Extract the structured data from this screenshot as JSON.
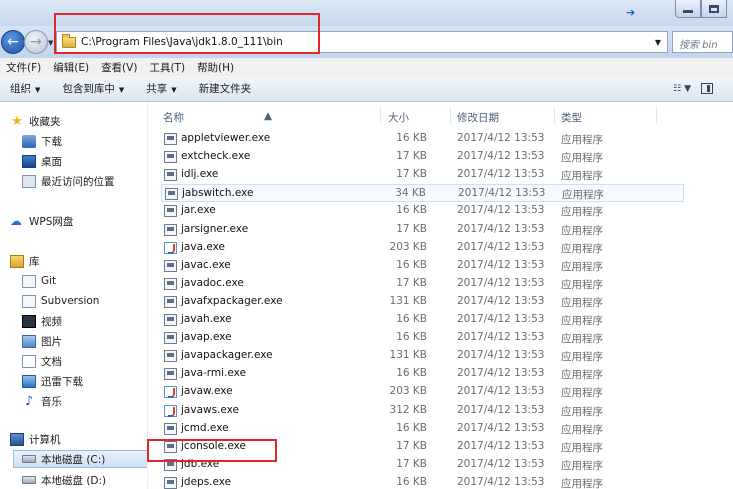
{
  "window": {
    "nav_arrow": "➔",
    "minimize": "minimize",
    "maximize": "maximize"
  },
  "address": {
    "path": "C:\\Program Files\\Java\\jdk1.8.0_111\\bin",
    "search_placeholder": "搜索 bin"
  },
  "menu": [
    "文件(F)",
    "编辑(E)",
    "查看(V)",
    "工具(T)",
    "帮助(H)"
  ],
  "commands": {
    "organize": "组织",
    "include_library": "包含到库中",
    "share": "共享",
    "new_folder": "新建文件夹"
  },
  "sidebar": {
    "favorites": "收藏夹",
    "downloads": "下载",
    "desktop": "桌面",
    "recent": "最近访问的位置",
    "wps": "WPS网盘",
    "libraries": "库",
    "git": "Git",
    "subversion": "Subversion",
    "videos": "视频",
    "pictures": "图片",
    "documents": "文档",
    "xunlei": "迅雷下载",
    "music": "音乐",
    "computer": "计算机",
    "disk_c": "本地磁盘 (C:)",
    "disk_d": "本地磁盘 (D:)"
  },
  "columns": {
    "name": "名称",
    "size": "大小",
    "modified": "修改日期",
    "type": "类型"
  },
  "files": [
    {
      "name": "appletviewer.exe",
      "size": "16 KB",
      "date": "2017/4/12 13:53",
      "type": "应用程序",
      "icon": "app"
    },
    {
      "name": "extcheck.exe",
      "size": "17 KB",
      "date": "2017/4/12 13:53",
      "type": "应用程序",
      "icon": "app"
    },
    {
      "name": "idlj.exe",
      "size": "17 KB",
      "date": "2017/4/12 13:53",
      "type": "应用程序",
      "icon": "app"
    },
    {
      "name": "jabswitch.exe",
      "size": "34 KB",
      "date": "2017/4/12 13:53",
      "type": "应用程序",
      "icon": "app"
    },
    {
      "name": "jar.exe",
      "size": "16 KB",
      "date": "2017/4/12 13:53",
      "type": "应用程序",
      "icon": "app"
    },
    {
      "name": "jarsigner.exe",
      "size": "17 KB",
      "date": "2017/4/12 13:53",
      "type": "应用程序",
      "icon": "app"
    },
    {
      "name": "java.exe",
      "size": "203 KB",
      "date": "2017/4/12 13:53",
      "type": "应用程序",
      "icon": "java"
    },
    {
      "name": "javac.exe",
      "size": "16 KB",
      "date": "2017/4/12 13:53",
      "type": "应用程序",
      "icon": "app"
    },
    {
      "name": "javadoc.exe",
      "size": "17 KB",
      "date": "2017/4/12 13:53",
      "type": "应用程序",
      "icon": "app"
    },
    {
      "name": "javafxpackager.exe",
      "size": "131 KB",
      "date": "2017/4/12 13:53",
      "type": "应用程序",
      "icon": "app"
    },
    {
      "name": "javah.exe",
      "size": "16 KB",
      "date": "2017/4/12 13:53",
      "type": "应用程序",
      "icon": "app"
    },
    {
      "name": "javap.exe",
      "size": "16 KB",
      "date": "2017/4/12 13:53",
      "type": "应用程序",
      "icon": "app"
    },
    {
      "name": "javapackager.exe",
      "size": "131 KB",
      "date": "2017/4/12 13:53",
      "type": "应用程序",
      "icon": "app"
    },
    {
      "name": "java-rmi.exe",
      "size": "16 KB",
      "date": "2017/4/12 13:53",
      "type": "应用程序",
      "icon": "app"
    },
    {
      "name": "javaw.exe",
      "size": "203 KB",
      "date": "2017/4/12 13:53",
      "type": "应用程序",
      "icon": "java"
    },
    {
      "name": "javaws.exe",
      "size": "312 KB",
      "date": "2017/4/12 13:53",
      "type": "应用程序",
      "icon": "java"
    },
    {
      "name": "jcmd.exe",
      "size": "16 KB",
      "date": "2017/4/12 13:53",
      "type": "应用程序",
      "icon": "app"
    },
    {
      "name": "jconsole.exe",
      "size": "17 KB",
      "date": "2017/4/12 13:53",
      "type": "应用程序",
      "icon": "app"
    },
    {
      "name": "jdb.exe",
      "size": "17 KB",
      "date": "2017/4/12 13:53",
      "type": "应用程序",
      "icon": "app"
    },
    {
      "name": "jdeps.exe",
      "size": "16 KB",
      "date": "2017/4/12 13:53",
      "type": "应用程序",
      "icon": "app"
    }
  ],
  "colors": {
    "highlight_box": "#e3262a",
    "hover_row": "#cfe0f2"
  }
}
